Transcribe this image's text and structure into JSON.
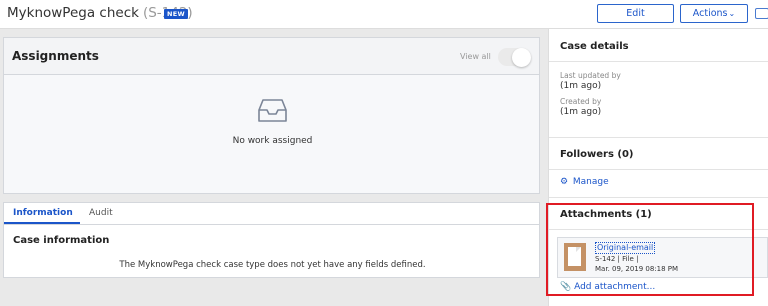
{
  "header": {
    "case_name": "MyknowPega check",
    "case_id": "(S-142)",
    "badge": "NEW",
    "edit_label": "Edit",
    "actions_label": "Actions"
  },
  "assignments": {
    "title": "Assignments",
    "view_all_label": "View all",
    "view_all_toggle_on": false,
    "empty_text": "No work assigned"
  },
  "info": {
    "tabs": [
      {
        "label": "Information",
        "active": true
      },
      {
        "label": "Audit",
        "active": false
      }
    ],
    "section_title": "Case information",
    "empty_message": "The MyknowPega check case type does not yet have any fields defined."
  },
  "case_details": {
    "title": "Case details",
    "last_updated_label": "Last updated by",
    "last_updated_value": "(1m ago)",
    "created_label": "Created by",
    "created_value": "(1m ago)"
  },
  "followers": {
    "title": "Followers (0)",
    "manage_label": "Manage"
  },
  "attachments": {
    "title": "Attachments (1)",
    "items": [
      {
        "name": "Original-email",
        "meta": "S-142 | File |",
        "date": "Mar. 09, 2019 08:18 PM"
      }
    ],
    "add_label": "Add attachment..."
  },
  "colors": {
    "accent": "#1b55c9",
    "highlight_border": "#e01b24",
    "file_thumb": "#c49165"
  }
}
